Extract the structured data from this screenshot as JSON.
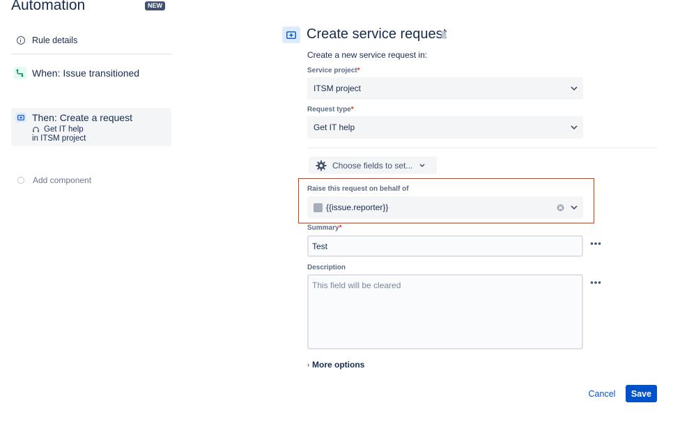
{
  "sidebar": {
    "app_title": "Automation",
    "badge": "NEW",
    "rule_details": "Rule details",
    "trigger": "When: Issue transitioned",
    "action": {
      "title": "Then: Create a request",
      "request_type": "Get IT help",
      "project": "in ITSM project"
    },
    "add_component": "Add component"
  },
  "panel": {
    "title": "Create service request",
    "intro": "Create a new service request in:",
    "service_project": {
      "label": "Service project",
      "value": "ITSM project"
    },
    "request_type": {
      "label": "Request type",
      "value": "Get IT help"
    },
    "choose_fields": "Choose fields to set...",
    "on_behalf": {
      "label": "Raise this request on behalf of",
      "value": "{{issue.reporter}}"
    },
    "summary": {
      "label": "Summary",
      "value": "Test"
    },
    "description": {
      "label": "Description",
      "placeholder": "This field will be cleared"
    },
    "more_options": "More options",
    "required_marker": "*"
  },
  "footer": {
    "cancel": "Cancel",
    "save": "Save"
  },
  "colors": {
    "accent": "#0052CC",
    "highlight": "#DE350B",
    "required": "#DE350B"
  }
}
